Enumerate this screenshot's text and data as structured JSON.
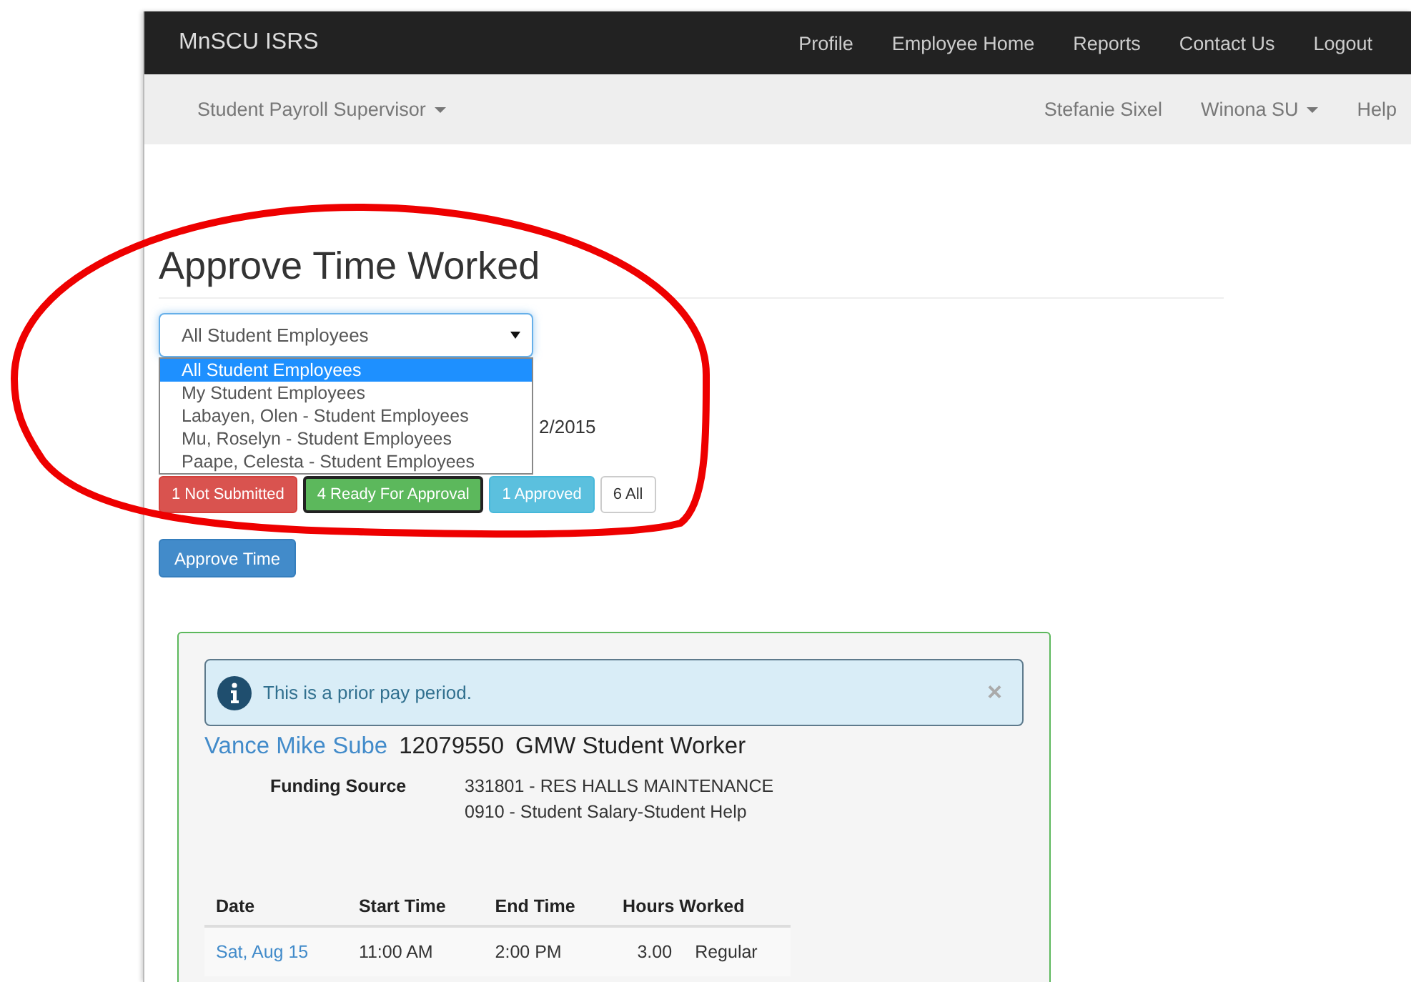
{
  "navbar": {
    "brand": "MnSCU ISRS",
    "links": [
      "Profile",
      "Employee Home",
      "Reports",
      "Contact Us",
      "Logout"
    ]
  },
  "subnav": {
    "role_menu": "Student Payroll Supervisor",
    "user": "Stefanie Sixel",
    "campus_menu": "Winona SU",
    "help": "Help"
  },
  "page_title": "Approve Time Worked",
  "employee_filter": {
    "value": "All Student Employees",
    "expanded": true,
    "options": [
      {
        "label": "All Student Employees",
        "selected": true
      },
      {
        "label": "My Student Employees",
        "selected": false
      },
      {
        "label": "Labayen, Olen - Student Employees",
        "selected": false
      },
      {
        "label": "Mu, Roselyn - Student Employees",
        "selected": false
      },
      {
        "label": "Paape, Celesta - Student Employees",
        "selected": false
      }
    ]
  },
  "period_text": "2/2015",
  "status_filters": [
    {
      "label": "1 Not Submitted",
      "kind": "danger",
      "selected": false
    },
    {
      "label": "4 Ready For Approval",
      "kind": "success",
      "selected": true
    },
    {
      "label": "1 Approved",
      "kind": "info",
      "selected": false
    },
    {
      "label": "6 All",
      "kind": "default",
      "selected": false
    }
  ],
  "approve_button": "Approve Time",
  "timesheet": {
    "alert": "This is a prior pay period.",
    "alert_close": "×",
    "employee_name": "Vance Mike Sube",
    "employee_id": "12079550",
    "job": "GMW Student Worker",
    "funding_label": "Funding Source",
    "funding_lines": [
      "331801 - RES HALLS MAINTENANCE",
      "0910 - Student Salary-Student Help"
    ],
    "columns": [
      "Date",
      "Start Time",
      "End Time",
      "Hours Worked"
    ],
    "rows": [
      {
        "date": "Sat, Aug 15",
        "start": "11:00 AM",
        "end": "2:00 PM",
        "hours": "3.00",
        "type": "Regular"
      }
    ]
  },
  "annotation": {
    "kind": "ellipse"
  }
}
